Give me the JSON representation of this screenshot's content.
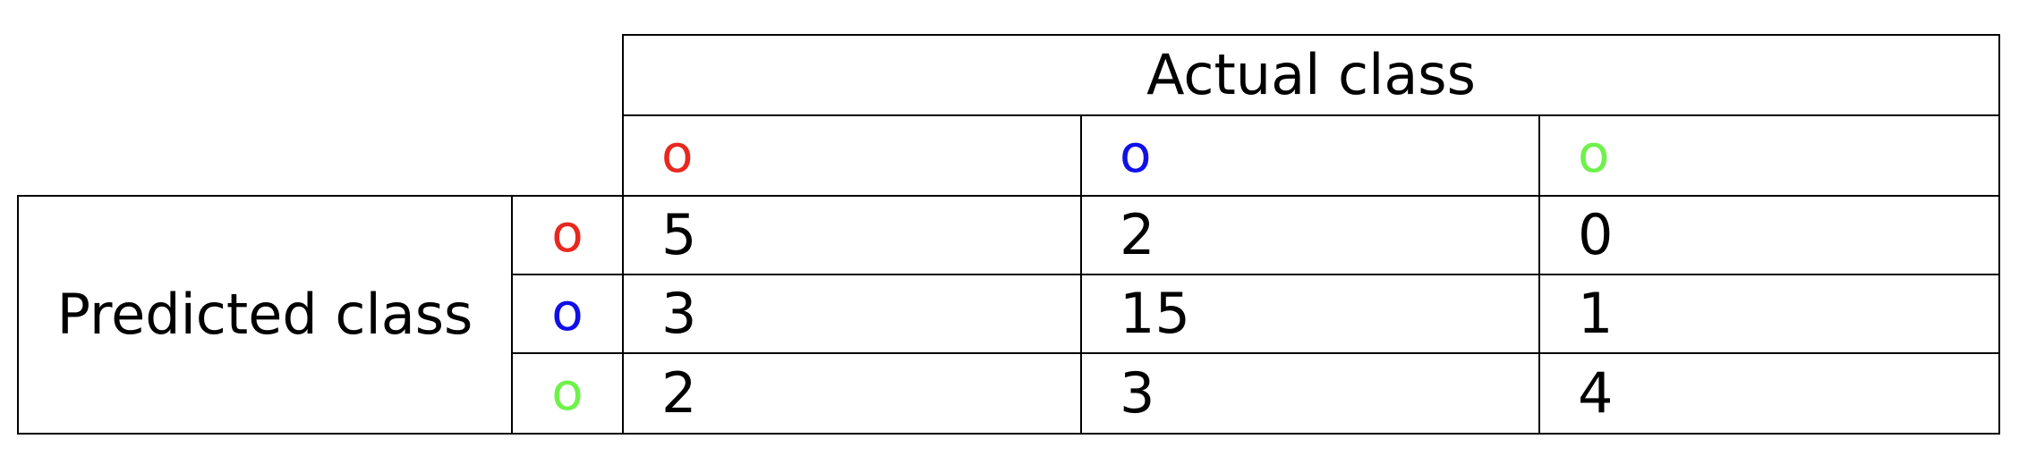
{
  "header": {
    "actual_label": "Actual class",
    "predicted_label": "Predicted class"
  },
  "classes": [
    {
      "symbol": "o",
      "color": "#e8281e"
    },
    {
      "symbol": "o",
      "color": "#1010e8"
    },
    {
      "symbol": "o",
      "color": "#6ef24a"
    }
  ],
  "matrix": [
    [
      "5",
      "2",
      "0"
    ],
    [
      "3",
      "15",
      "1"
    ],
    [
      "2",
      "3",
      "4"
    ]
  ]
}
